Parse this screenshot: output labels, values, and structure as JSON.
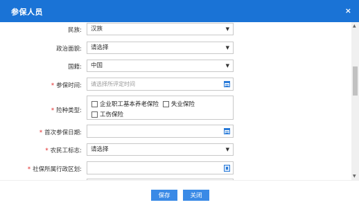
{
  "dialog": {
    "title": "参保人员",
    "close_symbol": "×"
  },
  "form": {
    "ethnicity": {
      "label": "民族:",
      "value": "汉族"
    },
    "political": {
      "label": "政治面貌:",
      "value": "请选择"
    },
    "nationality": {
      "label": "国籍:",
      "value": "中国"
    },
    "insured_time": {
      "label": "参保时间:",
      "placeholder": "请选择所评定时间"
    },
    "insurance_type": {
      "label": "险种类型:",
      "options": [
        "企业职工基本养老保险",
        "失业保险",
        "工伤保险"
      ]
    },
    "first_date": {
      "label": "首次参保日期:",
      "value": ""
    },
    "migrant_flag": {
      "label": "农民工标志:",
      "value": "请选择"
    },
    "region": {
      "label": "社保所属行政区划:",
      "value": ""
    }
  },
  "footer": {
    "save_label": "保存",
    "close_label": "关闭"
  },
  "colors": {
    "title_bar": "#1a73d6",
    "button": "#3a8ae6",
    "required": "#e02020"
  }
}
